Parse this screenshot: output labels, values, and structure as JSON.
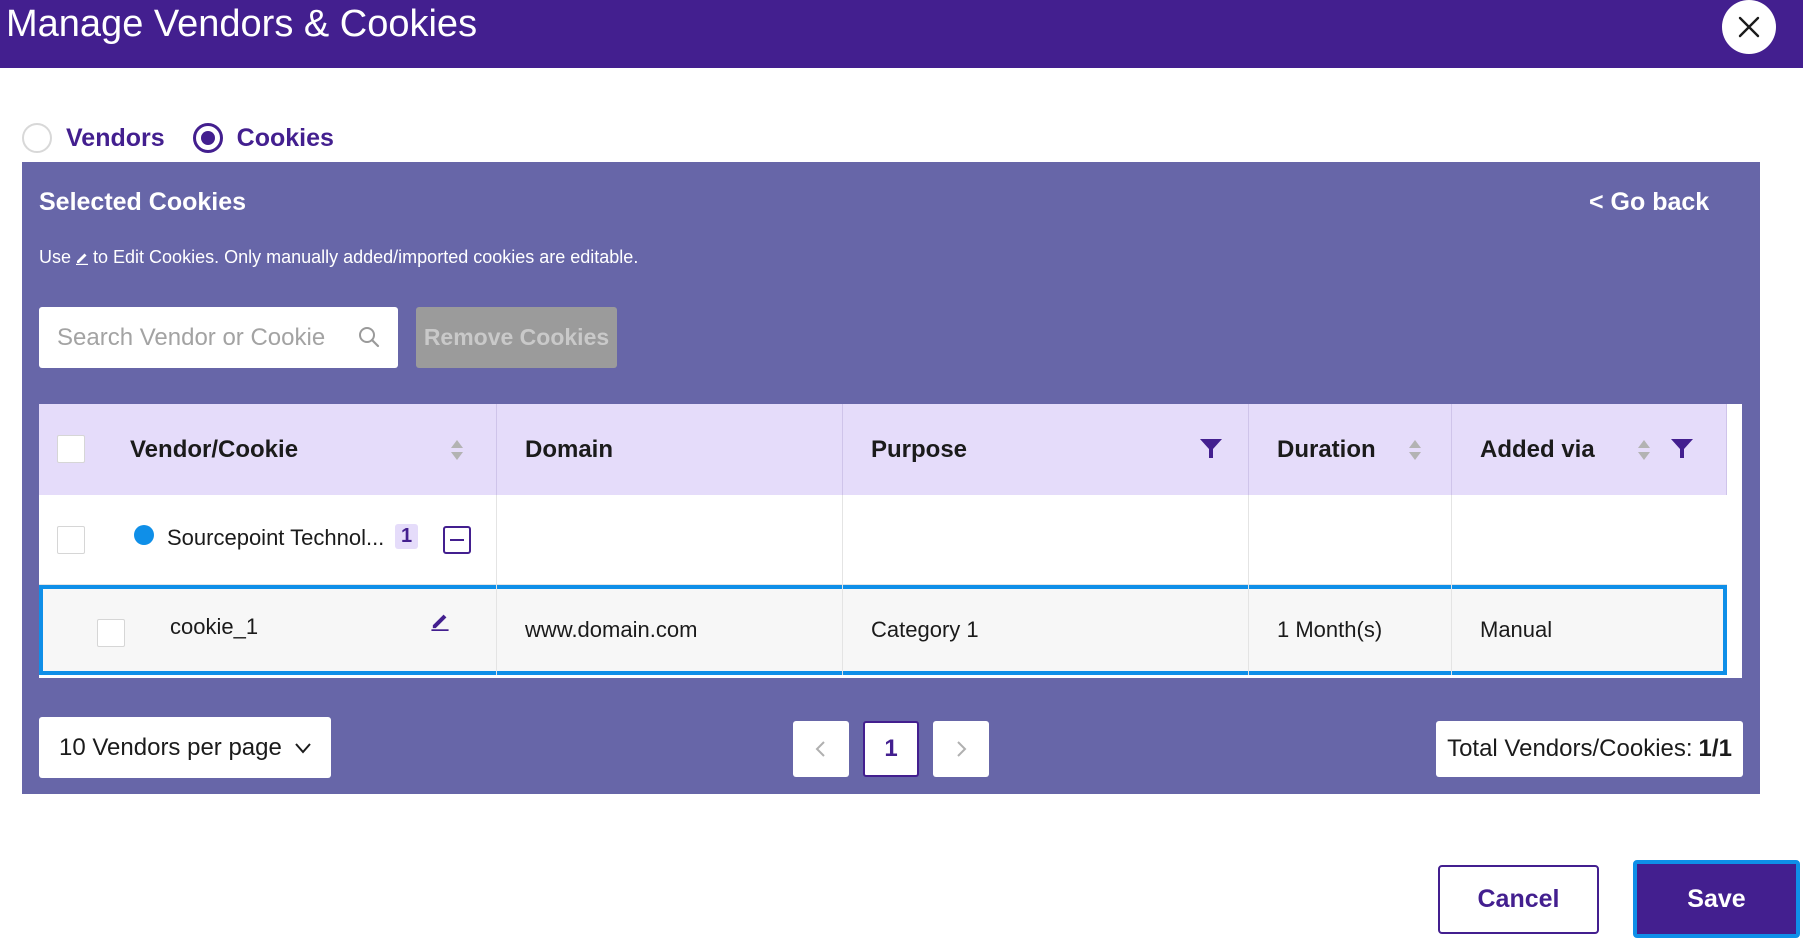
{
  "modal": {
    "title": "Manage Vendors & Cookies",
    "close_icon": "close-icon"
  },
  "view_toggle": {
    "options": [
      {
        "label": "Vendors",
        "selected": false
      },
      {
        "label": "Cookies",
        "selected": true
      }
    ]
  },
  "panel": {
    "title": "Selected Cookies",
    "go_back": "< Go back",
    "hint_before": "Use",
    "hint_after": "to Edit Cookies. Only manually added/imported cookies are editable.",
    "search_placeholder": "Search Vendor or Cookie",
    "remove_button": "Remove Cookies"
  },
  "table": {
    "columns": [
      "Vendor/Cookie",
      "Domain",
      "Purpose",
      "Duration",
      "Added via"
    ],
    "vendor_row": {
      "name": "Sourcepoint Technol...",
      "count": "1"
    },
    "cookie_row": {
      "name": "cookie_1",
      "domain": "www.domain.com",
      "purpose": "Category 1",
      "duration": "1 Month(s)",
      "added_via": "Manual"
    }
  },
  "pagination": {
    "per_page": "10 Vendors per page",
    "current_page": "1",
    "total_label": "Total Vendors/Cookies:",
    "total_value": "1/1"
  },
  "footer": {
    "cancel": "Cancel",
    "save": "Save"
  },
  "colors": {
    "brand": "#431f8f",
    "panel": "#6766a8",
    "header_row": "#e5dcfa",
    "selection": "#0f8fe8"
  }
}
